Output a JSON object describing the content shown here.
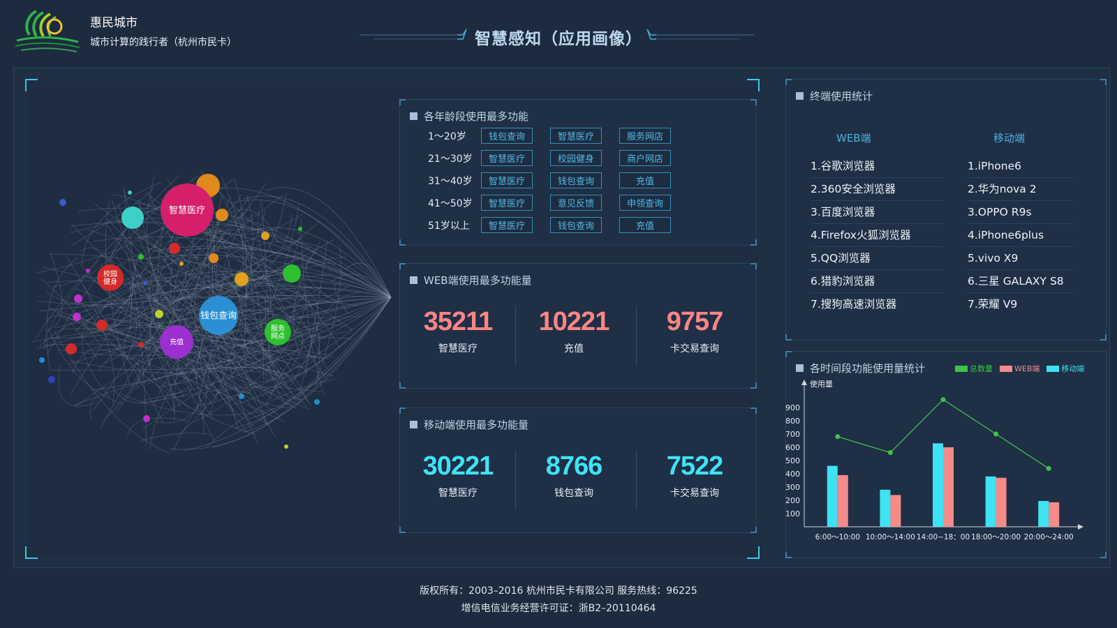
{
  "header": {
    "brand_title": "惠民城市",
    "brand_subtitle": "城市计算的践行者（杭州市民卡）",
    "page_title": "智慧感知（应用画像）"
  },
  "network": {
    "nodes": [
      {
        "label": "智慧医疗",
        "color": "#d61f6b"
      },
      {
        "label": "钱包查询",
        "color": "#2a8fd4"
      },
      {
        "label": "充值",
        "color": "#9b2fd0"
      },
      {
        "label": "校园\n健身",
        "color": "#d42a2a"
      },
      {
        "label": "服务\n网点",
        "color": "#2ec02e"
      }
    ]
  },
  "age_panel": {
    "title": "各年龄段使用最多功能",
    "rows": [
      {
        "age": "1～20岁",
        "tags": [
          "钱包查询",
          "智慧医疗",
          "服务网店"
        ]
      },
      {
        "age": "21～30岁",
        "tags": [
          "智慧医疗",
          "校园健身",
          "商户网店"
        ]
      },
      {
        "age": "31～40岁",
        "tags": [
          "智慧医疗",
          "钱包查询",
          "充值"
        ]
      },
      {
        "age": "41～50岁",
        "tags": [
          "智慧医疗",
          "意见反馈",
          "申领查询"
        ]
      },
      {
        "age": "51岁以上",
        "tags": [
          "智慧医疗",
          "钱包查询",
          "充值"
        ]
      }
    ]
  },
  "web_panel": {
    "title": "WEB端使用最多功能量",
    "stats": [
      {
        "value": "35211",
        "name": "智慧医疗"
      },
      {
        "value": "10221",
        "name": "充值"
      },
      {
        "value": "9757",
        "name": "卡交易查询"
      }
    ]
  },
  "mobile_panel": {
    "title": "移动端使用最多功能量",
    "stats": [
      {
        "value": "30221",
        "name": "智慧医疗"
      },
      {
        "value": "8766",
        "name": "钱包查询"
      },
      {
        "value": "7522",
        "name": "卡交易查询"
      }
    ]
  },
  "terminal_panel": {
    "title": "终端使用统计",
    "web_header": "WEB端",
    "mobile_header": "移动端",
    "web": [
      "1.谷歌浏览器",
      "2.360安全浏览器",
      "3.百度浏览器",
      "4.Firefox火狐浏览器",
      "5.QQ浏览器",
      "6.猎豹浏览器",
      "7.搜狗高速浏览器"
    ],
    "mobile": [
      "1.iPhone6",
      "2.华为nova 2",
      "3.OPPO R9s",
      "4.iPhone6plus",
      "5.vivo X9",
      "6.三星 GALAXY S8",
      "7.荣耀 V9"
    ]
  },
  "time_panel": {
    "title": "各时间段功能使用量统计"
  },
  "chart_data": {
    "type": "bar",
    "ylabel": "使用量",
    "ylim": [
      0,
      1000
    ],
    "yticks": [
      100,
      200,
      300,
      400,
      500,
      600,
      700,
      800,
      900
    ],
    "categories": [
      "6:00～10:00",
      "10:00～14:00",
      "14:00~18：00",
      "18:00～20:00",
      "20:00～24:00"
    ],
    "legend_position": "top-right",
    "series": [
      {
        "name": "总数量",
        "type": "line",
        "color": "#3cc445",
        "values": [
          680,
          560,
          960,
          700,
          440
        ]
      },
      {
        "name": "WEB端",
        "type": "bar",
        "color": "#f48b8b",
        "values": [
          390,
          240,
          600,
          370,
          185
        ]
      },
      {
        "name": "移动端",
        "type": "bar",
        "color": "#3de2f3",
        "values": [
          460,
          280,
          630,
          380,
          195
        ]
      }
    ]
  },
  "footer": {
    "line1": "版权所有：2003–2016  杭州市民卡有限公司  服务热线：96225",
    "line2": "增信电信业务经营许可证：浙B2–20110464"
  }
}
